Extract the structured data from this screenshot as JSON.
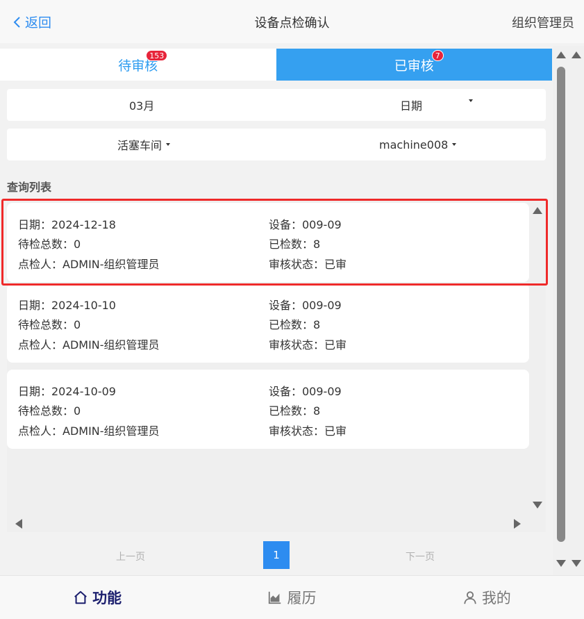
{
  "header": {
    "back_label": "返回",
    "title": "设备点检确认",
    "role": "组织管理员"
  },
  "tabs": [
    {
      "label": "待审核",
      "badge": "153"
    },
    {
      "label": "已审核",
      "badge": "7"
    }
  ],
  "filters": {
    "month": "03月",
    "date": "日期",
    "workshop": "活塞车间",
    "machine": "machine008"
  },
  "section_title": "查询列表",
  "records": [
    {
      "date": "日期：2024-12-18",
      "device": "设备：009-09",
      "pending": "待检总数：0",
      "checked": "已检数：8",
      "inspector": "点检人：ADMIN-组织管理员",
      "status": "审核状态：已审"
    },
    {
      "date": "日期：2024-10-10",
      "device": "设备：009-09",
      "pending": "待检总数：0",
      "checked": "已检数：8",
      "inspector": "点检人：ADMIN-组织管理员",
      "status": "审核状态：已审"
    },
    {
      "date": "日期：2024-10-09",
      "device": "设备：009-09",
      "pending": "待检总数：0",
      "checked": "已检数：8",
      "inspector": "点检人：ADMIN-组织管理员",
      "status": "审核状态：已审"
    }
  ],
  "pagination": {
    "prev": "上一页",
    "current": "1",
    "next": "下一页"
  },
  "bottom_nav": [
    {
      "label": "功能",
      "icon": "home-icon"
    },
    {
      "label": "履历",
      "icon": "chart-icon"
    },
    {
      "label": "我的",
      "icon": "user-icon"
    }
  ],
  "colors": {
    "accent": "#2d8cf0",
    "active_tab": "#35a0f0",
    "badge": "#e7243a",
    "highlight": "#ef2a2a",
    "nav_active": "#1c1f6e"
  }
}
